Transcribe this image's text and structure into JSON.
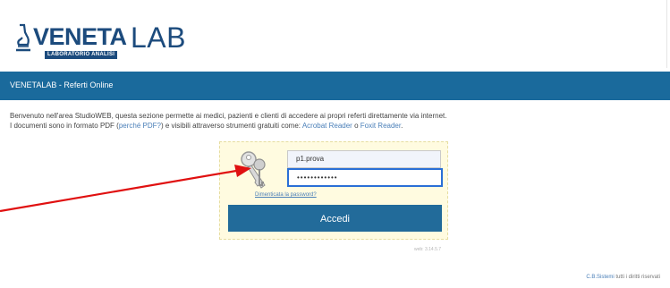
{
  "header": {
    "logo_word_main": "VENETA",
    "logo_word_lab": "LAB",
    "logo_subtitle": "LABORATORIO ANALISI",
    "bar_title": "VENETALAB - Referti Online"
  },
  "intro": {
    "line1": "Benvenuto nell'area StudioWEB, questa sezione permette ai medici, pazienti e clienti di accedere ai propri referti direttamente via internet.",
    "line2_prefix": "I documenti sono in formato PDF (",
    "line2_link_pdf": "perché PDF?",
    "line2_middle": ") e visibili attraverso strumenti gratuiti come: ",
    "line2_link_acrobat": "Acrobat Reader",
    "line2_or": " o ",
    "line2_link_foxit": "Foxit Reader",
    "line2_end": "."
  },
  "login": {
    "username_value": "p1.prova",
    "password_value": "••••••••••••",
    "forgot_label": "Dimenticata la password?",
    "submit_label": "Accedi",
    "version": "web: 3.14.5.7"
  },
  "footer": {
    "company": "C.B.Sistemi",
    "rights": " tutti i diritti riservati"
  },
  "colors": {
    "brand_blue": "#1a6a9c",
    "login_bg": "#fffbe0",
    "focus_border": "#2a6fd6",
    "annotation": "#e01010"
  },
  "icons": {
    "logo": "microscope-icon",
    "login": "keys-icon",
    "annotation": "red-arrow-icon"
  }
}
